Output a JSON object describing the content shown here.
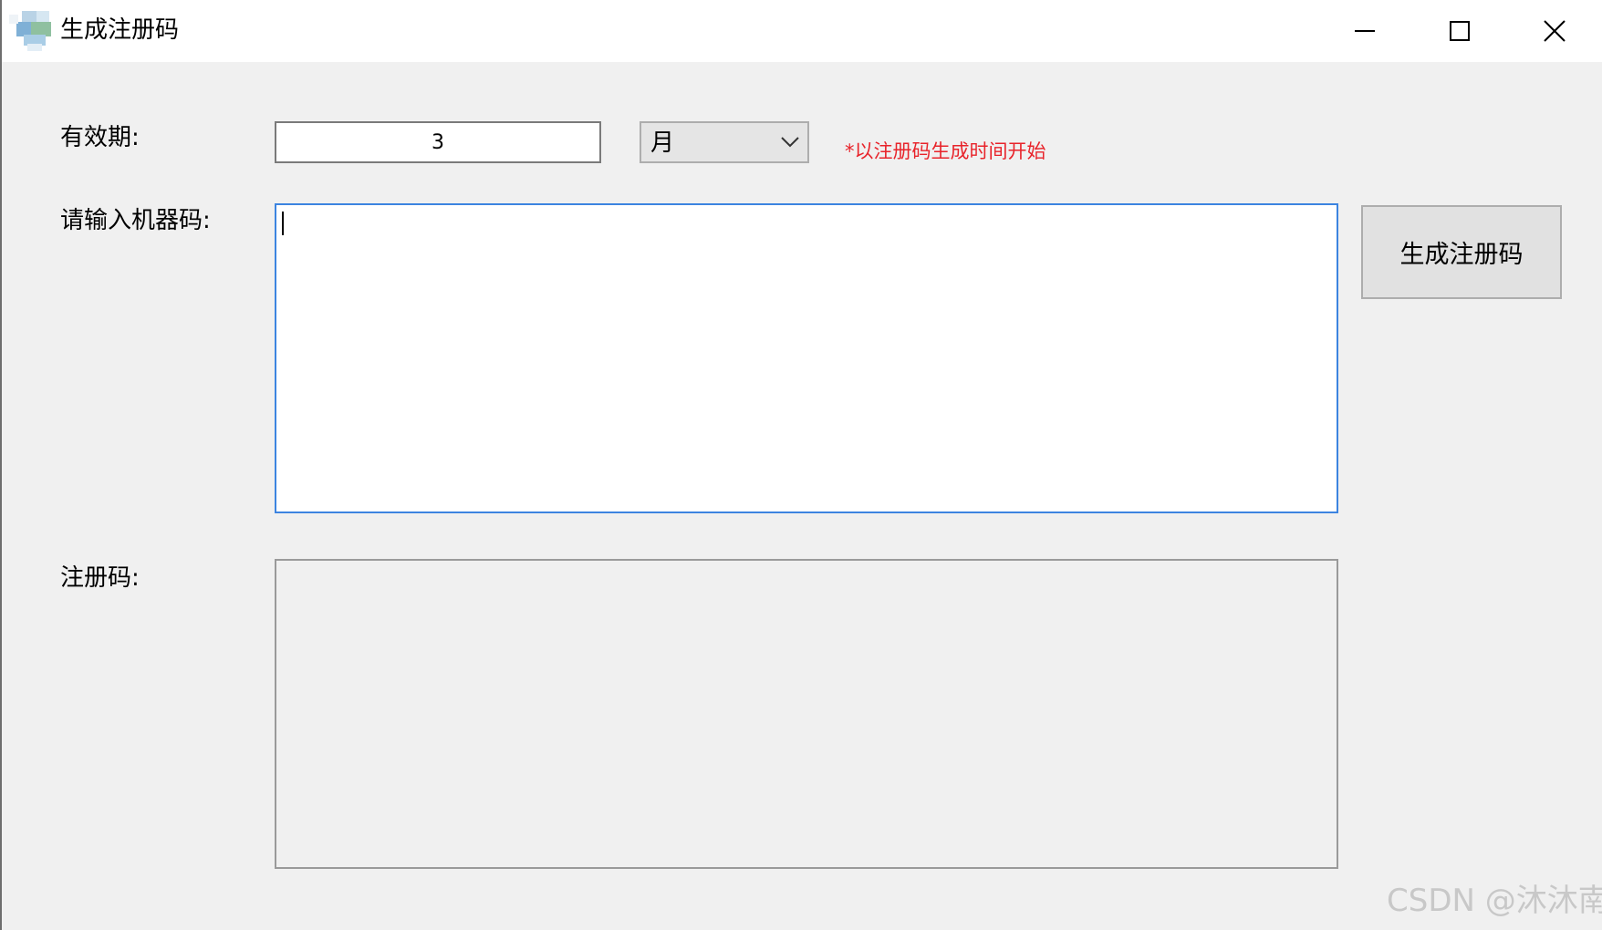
{
  "window": {
    "title": "生成注册码",
    "app_icon": "app-icon",
    "controls": {
      "minimize_icon": "minimize-icon",
      "maximize_icon": "maximize-icon",
      "close_icon": "close-icon"
    }
  },
  "form": {
    "validity_label": "有效期:",
    "validity_value": "3",
    "unit_selected": "月",
    "unit_dropdown_icon": "chevron-down-icon",
    "hint": "*以注册码生成时间开始",
    "hint_color": "#e8242b",
    "machine_code_label": "请输入机器码:",
    "machine_code_value": "",
    "generate_button_label": "生成注册码",
    "reg_code_label": "注册码:",
    "reg_code_value": ""
  },
  "watermark": "CSDN @沐沐南"
}
